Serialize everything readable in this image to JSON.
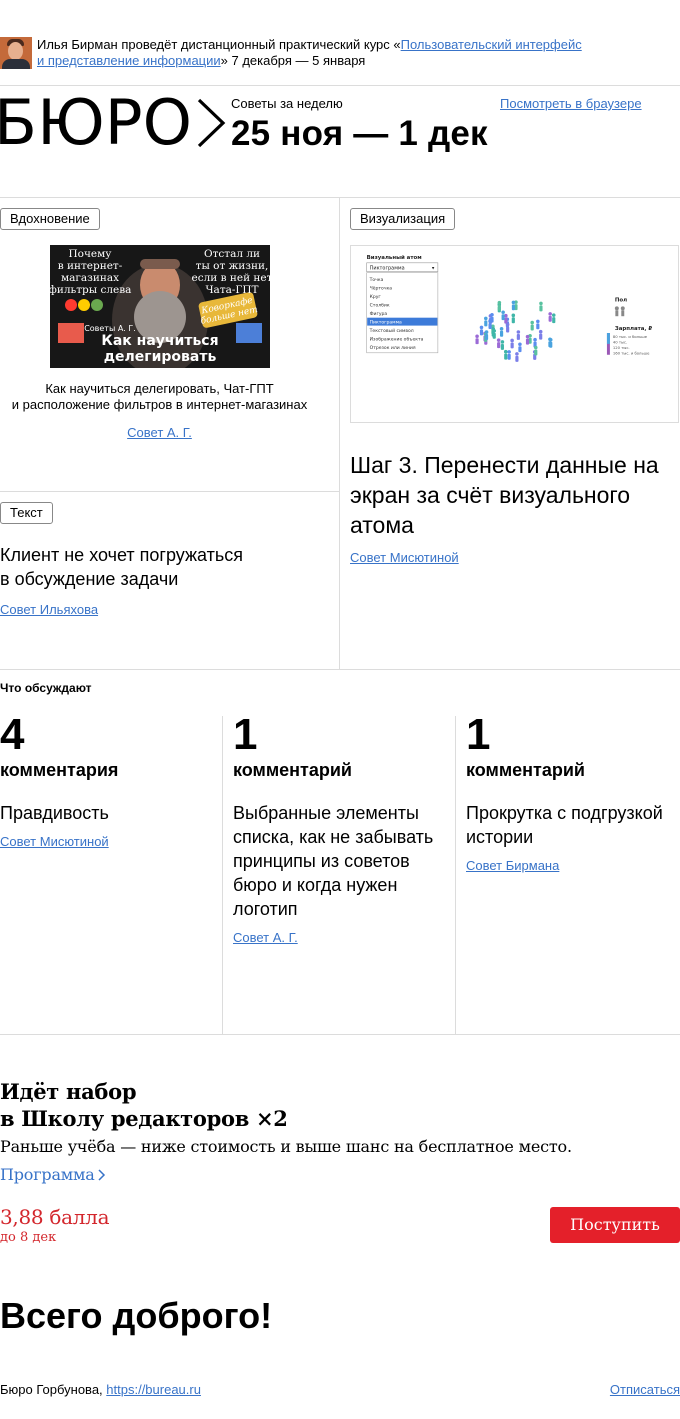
{
  "announcement": {
    "prefix": "Илья Бирман проведёт дистанционный практический курс «",
    "course_link_line1": "Пользовательский интерфейс",
    "course_link_line2": "и представление информации",
    "suffix": "» 7 декабря — 5 января"
  },
  "header": {
    "logo_text": "БЮРО",
    "weekly_label": "Советы за неделю",
    "date_range": "25 ноя — 1 дек",
    "view_in_browser": "Посмотреть в браузере"
  },
  "cards": {
    "inspiration": {
      "tag": "Вдохновение",
      "thumb": {
        "left_text": [
          "Почему",
          "в интернет-",
          "магазинах",
          "фильтры слева"
        ],
        "right_text": [
          "Отстал ли",
          "ты от жизни,",
          "если в ней нет",
          "Чата-ГПТ"
        ],
        "sticker": [
          "Коворкафе",
          "больше нет"
        ],
        "badge": "Советы А. Г.",
        "headline": [
          "Как научиться",
          "делегировать"
        ]
      },
      "caption_line1": "Как научиться делегировать, Чат-ГПТ",
      "caption_line2": "и расположение фильтров в интернет-магазинах",
      "author": "Совет А. Г."
    },
    "visualization": {
      "tag": "Визуализация",
      "thumb": {
        "panel_title": "Визуальный атом",
        "select_value": "Пиктограмма",
        "options": [
          "Точка",
          "Чёрточка",
          "Круг",
          "Столбик",
          "Фигура",
          "Пиктограмма",
          "Текстовый символ",
          "Изображение объекта",
          "Отрезок или линия"
        ],
        "legend_title": "Пол",
        "legend_sub": "Зарплата, ₽",
        "legend_rows": [
          "80 тыс. и больше",
          "40 тыс.",
          "120 тыс.",
          "160 тыс. и больше"
        ]
      },
      "title": "Шаг 3. Перенести данные на экран за счёт визуального атома",
      "author": "Совет Мисютиной"
    },
    "text": {
      "tag": "Текст",
      "title_line1": "Клиент не хочет погружаться",
      "title_line2": "в обсуждение задачи",
      "author": "Совет Ильяхова"
    }
  },
  "discussion": {
    "heading": "Что обсуждают",
    "items": [
      {
        "count": "4",
        "unit": "комментария",
        "title": "Правдивость",
        "author": "Совет Мисютиной"
      },
      {
        "count": "1",
        "unit": "комментарий",
        "title": "Выбранные элементы списка, как не забывать принципы из советов бюро и когда нужен логотип",
        "author": "Совет А. Г."
      },
      {
        "count": "1",
        "unit": "комментарий",
        "title": "Прокрутка с подгрузкой истории",
        "author": "Совет Бирмана"
      }
    ]
  },
  "promo": {
    "heading_line1": "Идёт набор",
    "heading_line2": "в Школу редакторов",
    "heading_badge": "×2",
    "subtitle": "Раньше учёба — ниже стоимость и выше шанс на бесплатное место.",
    "program_link": "Программа",
    "price": "3,88 балла",
    "until": "до 8 дек",
    "apply_button": "Поступить"
  },
  "farewell": "Всего доброго!",
  "footer": {
    "company": "Бюро Горбунова, ",
    "site_link": "https://bureau.ru",
    "unsubscribe": "Отписаться"
  },
  "colors": {
    "link": "#3873c8",
    "accent_red": "#e4202a",
    "price_red": "#d3262c",
    "rule": "#dcdcdc"
  }
}
